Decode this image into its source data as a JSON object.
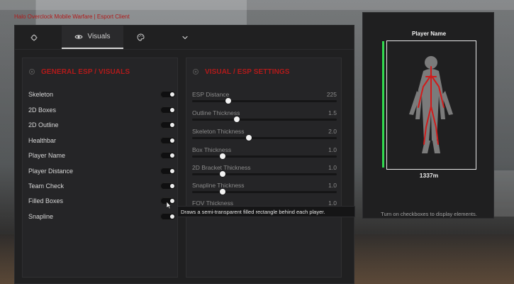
{
  "header": {
    "text": "Halo Overclock Mobile Warfare | Esport Client"
  },
  "tabs": {
    "visuals_label": "Visuals"
  },
  "left_card": {
    "title": "GENERAL ESP / VISUALS",
    "items": [
      {
        "label": "Skeleton"
      },
      {
        "label": "2D Boxes"
      },
      {
        "label": "2D Outline"
      },
      {
        "label": "Healthbar"
      },
      {
        "label": "Player Name"
      },
      {
        "label": "Player Distance"
      },
      {
        "label": "Team Check"
      },
      {
        "label": "Filled Boxes"
      },
      {
        "label": "Snapline"
      }
    ]
  },
  "right_card": {
    "title": "VISUAL / ESP SETTINGS",
    "sliders": [
      {
        "label": "ESP Distance",
        "value": "225",
        "fill": 0.24
      },
      {
        "label": "Outline Thickness",
        "value": "1.5",
        "fill": 0.3
      },
      {
        "label": "Skeleton Thickness",
        "value": "2.0",
        "fill": 0.39
      },
      {
        "label": "Box Thickness",
        "value": "1.0",
        "fill": 0.2
      },
      {
        "label": "2D Bracket Thickness",
        "value": "1.0",
        "fill": 0.2
      },
      {
        "label": "Snapline Thickness",
        "value": "1.0",
        "fill": 0.2
      },
      {
        "label": "FOV Thickness",
        "value": "1.0",
        "fill": 0.2
      }
    ]
  },
  "preview": {
    "title": "Player Name",
    "distance": "1337m",
    "hint": "Turn on checkboxes to display elements."
  },
  "tooltip": {
    "text": "Draws a semi-transparent filled rectangle behind each player."
  },
  "colors": {
    "accent_red": "#b21a1a",
    "health_green": "#32d94f",
    "panel_dark": "#202021"
  },
  "icons": {
    "home": "crosshair-icon",
    "visuals": "eye-icon",
    "palette": "palette-icon",
    "more": "chevron-down-icon",
    "left_section": "gear-icon",
    "right_section": "gear-icon"
  }
}
